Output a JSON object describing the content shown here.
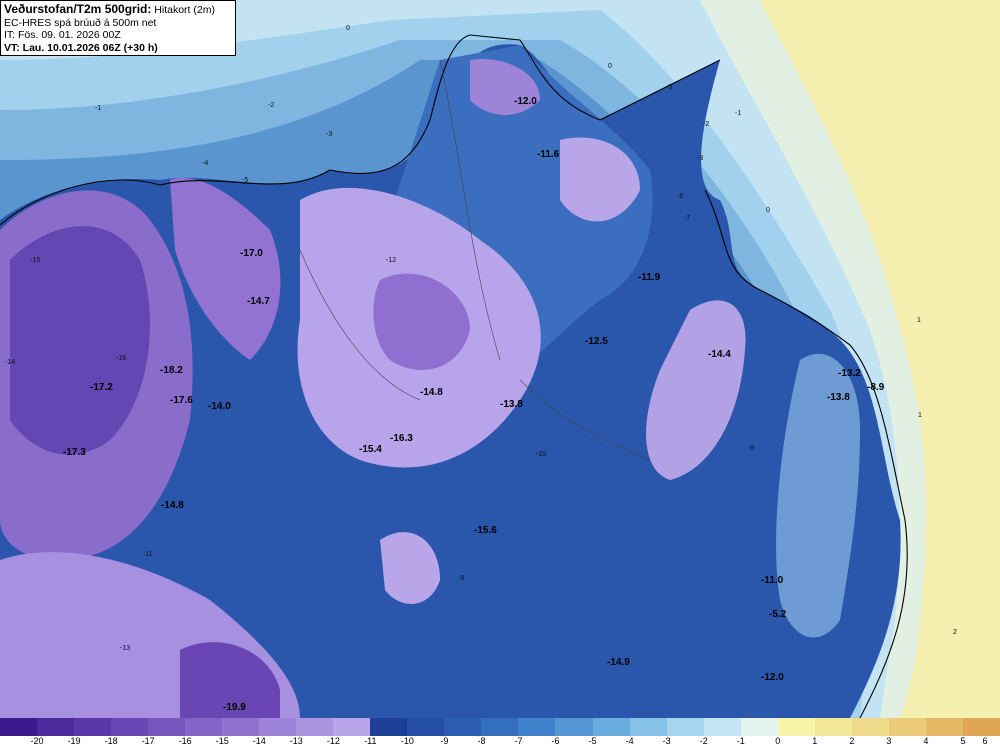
{
  "header": {
    "title_bold": "Veðurstofan/T2m 500grid:",
    "title_rest": " Hitakort (2m)",
    "model": "EC-HRES spá brúuð á 500m net",
    "issue_time": "IT: Fös. 09. 01. 2026 00Z",
    "valid_time": "VT: Lau. 10.01.2026 06Z (+30 h)"
  },
  "legend": {
    "labels": [
      "-20",
      "-19",
      "-18",
      "-17",
      "-16",
      "-15",
      "-14",
      "-13",
      "-12",
      "-11",
      "-10",
      "-9",
      "-8",
      "-7",
      "-6",
      "-5",
      "-4",
      "-3",
      "-2",
      "-1",
      "0",
      "1",
      "2",
      "3",
      "4",
      "5",
      "6"
    ],
    "colors": [
      "#3a1a8c",
      "#4b2a9c",
      "#5a37a8",
      "#6a46b4",
      "#7755bd",
      "#8464c6",
      "#9173cf",
      "#9e84d8",
      "#ab95e0",
      "#b8a6e8",
      "#1d3f96",
      "#244ea5",
      "#2b5db3",
      "#336ebf",
      "#3f81ca",
      "#5396d3",
      "#6aabdd",
      "#86c2e8",
      "#a4d6f0",
      "#c4e6f4",
      "#e3f3f0",
      "#f7f3a8",
      "#f3e79a",
      "#efd98a",
      "#ebca78",
      "#e5b966",
      "#dfa654"
    ]
  },
  "map_labels": [
    {
      "text": "-12.0"
    },
    {
      "text": "-11.6"
    },
    {
      "text": "-17.0"
    },
    {
      "text": "-14.7"
    },
    {
      "text": "-11.9"
    },
    {
      "text": "-12.5"
    },
    {
      "text": "-14.4"
    },
    {
      "text": "-13.2"
    },
    {
      "text": "-8.9"
    },
    {
      "text": "-13.8"
    },
    {
      "text": "-17.2"
    },
    {
      "text": "-18.2"
    },
    {
      "text": "-17.6"
    },
    {
      "text": "-14.0"
    },
    {
      "text": "-14.8"
    },
    {
      "text": "-13.8"
    },
    {
      "text": "-16.3"
    },
    {
      "text": "-15.4"
    },
    {
      "text": "-17.3"
    },
    {
      "text": "-14.8"
    },
    {
      "text": "-15.6"
    },
    {
      "text": "-11.0"
    },
    {
      "text": "-5.2"
    },
    {
      "text": "-14.9"
    },
    {
      "text": "-12.0"
    },
    {
      "text": "-19.9"
    }
  ],
  "contour_labels": [
    "0",
    "-1",
    "-2",
    "-3",
    "-4",
    "-5",
    "0",
    "0",
    "1",
    "1",
    "2",
    "-1",
    "-2",
    "-3",
    "-5",
    "-6",
    "-7",
    "-8",
    "-9",
    "-10",
    "-11",
    "-12",
    "-13",
    "-14",
    "-15",
    "-16"
  ]
}
